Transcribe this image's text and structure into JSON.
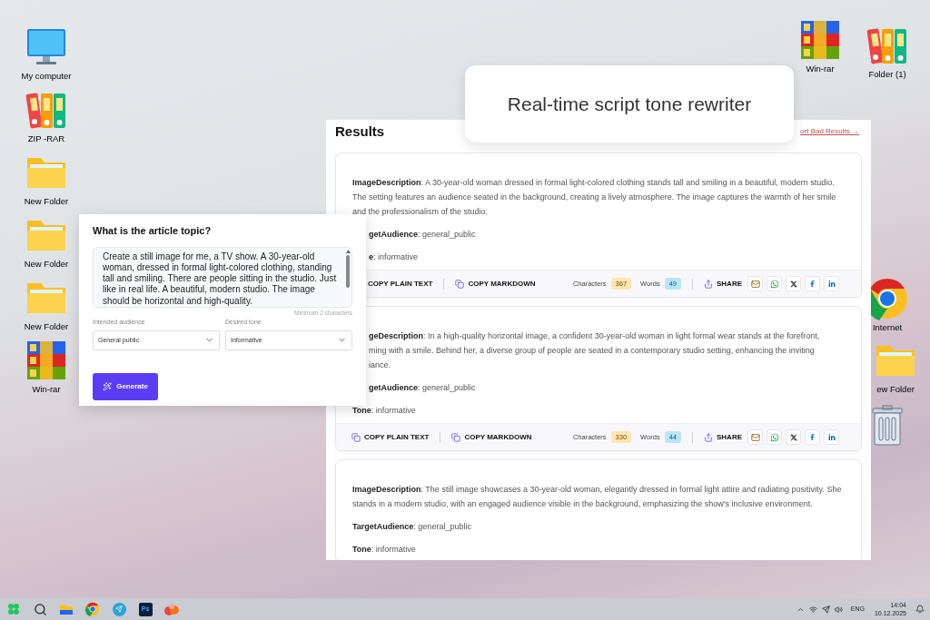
{
  "desktop_left": [
    {
      "kind": "monitor",
      "label": "My computer"
    },
    {
      "kind": "binders",
      "label": "ZIP -RAR"
    },
    {
      "kind": "folder",
      "label": "New Folder"
    },
    {
      "kind": "folder",
      "label": "New Folder"
    },
    {
      "kind": "folder",
      "label": "New Folder"
    },
    {
      "kind": "archive",
      "label": "Win-rar"
    }
  ],
  "desktop_right": [
    {
      "kind": "archive",
      "label": "Win-rar"
    },
    {
      "kind": "binders",
      "label": "Folder (1)"
    },
    {
      "kind": "chrome",
      "label": "Internet"
    },
    {
      "kind": "folder",
      "label": "ew Folder"
    },
    {
      "kind": "trash"
    }
  ],
  "title_card": {
    "title": "Real-time script tone rewriter"
  },
  "results": {
    "title": "Results",
    "report_link": "ort Bad Results →",
    "cards": [
      {
        "fields": [
          {
            "lines": [
              "**ImageDescription**: A 30-year-old woman dressed in formal light-colored clothing stands tall and smiling in a beautiful, modern studio. The setting features an audience seated in the background, creating a lively atmosphere. The image captures the warmth of her smile and the professionalism of the studio."
            ],
            "partly_hidden": false
          },
          {
            "lines": [
              "**getAudience**: general_public"
            ],
            "partly_hidden": true
          },
          {
            "lines": [
              "**e**: informative"
            ],
            "partly_hidden": true
          }
        ],
        "footer": {
          "copy_plain": "COPY PLAIN TEXT",
          "copy_plain_icon": false,
          "copy_markdown": "COPY MARKDOWN",
          "characters_label": "Characters",
          "characters": "367",
          "words_label": "Words",
          "words": "49",
          "share": "SHARE"
        }
      },
      {
        "fields": [
          {
            "lines": [
              "**geDescription**: In a high-quality horizontal image, a confident 30-year-old woman in light formal wear stands at the forefront,",
              "ming with a smile. Behind her, a diverse group of people are seated in a contemporary studio setting, enhancing the inviting",
              "iance."
            ],
            "partly_hidden": true
          },
          {
            "lines": [
              "**getAudience**: general_public"
            ],
            "partly_hidden": true
          },
          {
            "lines": [
              "**Tone**: informative"
            ],
            "partly_hidden": false
          }
        ],
        "footer": {
          "copy_plain": "COPY PLAIN TEXT",
          "copy_plain_icon": true,
          "copy_markdown": "COPY MARKDOWN",
          "characters_label": "Characters",
          "characters": "330",
          "words_label": "Words",
          "words": "44",
          "share": "SHARE"
        }
      },
      {
        "fields": [
          {
            "lines": [
              "**ImageDescription**: The still image showcases a 30-year-old woman, elegantly dressed in formal light attire and radiating positivity. She stands in a modern studio, with an engaged audience visible in the background, emphasizing the show’s inclusive environment."
            ],
            "partly_hidden": false
          },
          {
            "lines": [
              "**TargetAudience**: general_public"
            ],
            "partly_hidden": false
          },
          {
            "lines": [
              "**Tone**: informative"
            ],
            "partly_hidden": false
          }
        ]
      }
    ]
  },
  "form": {
    "question": "What is the article topic?",
    "topic": "Create a still image for me, a TV show. A 30-year-old woman, dressed in formal light-colored clothing, standing tall and smiling. There are people sitting in the studio. Just like in real life. A beautiful, modern studio. The image should be horizontal and high-quality.",
    "hint": "Minimum 2 characters",
    "audience_label": "Intended audience",
    "audience": "General public",
    "tone_label": "Desired tone",
    "tone": "Informative",
    "generate": "Generate"
  },
  "taskbar": {
    "apps": [
      {
        "kind": "start"
      },
      {
        "kind": "search"
      },
      {
        "kind": "explorer"
      },
      {
        "kind": "chrome"
      },
      {
        "kind": "telegram"
      },
      {
        "kind": "photoshop",
        "label": "Ps"
      },
      {
        "kind": "app"
      }
    ],
    "language": "ENG",
    "time": "14:04",
    "date": "10.12.2025"
  }
}
